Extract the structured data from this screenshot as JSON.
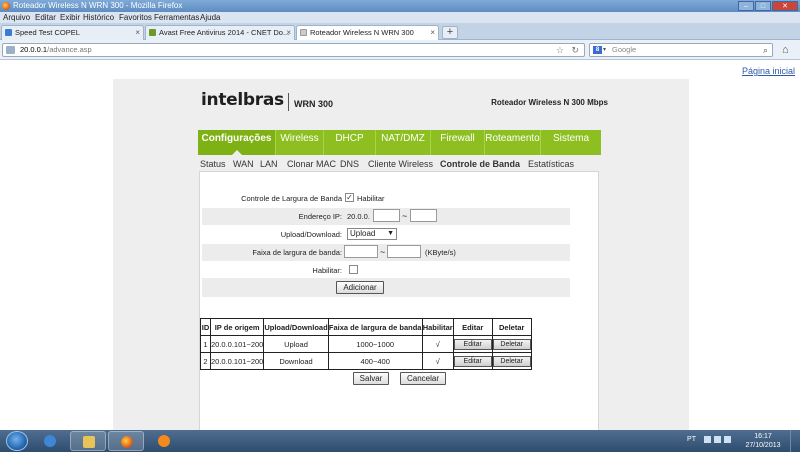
{
  "window": {
    "title": "Roteador Wireless N WRN 300 - Mozilla Firefox"
  },
  "menu": {
    "items": [
      "Arquivo",
      "Editar",
      "Exibir",
      "Histórico",
      "Favoritos",
      "Ferramentas",
      "Ajuda"
    ]
  },
  "tabs": [
    {
      "label": "Speed Test COPEL",
      "active": false,
      "favicon_color": "#3a7bd5"
    },
    {
      "label": "Avast Free Antivirus 2014 - CNET Do...",
      "active": false,
      "favicon_color": "#6b9a2a"
    },
    {
      "label": "Roteador Wireless N WRN 300",
      "active": true,
      "favicon_color": "#cccccc"
    }
  ],
  "toolbar": {
    "url_host": "20.0.0.1",
    "url_path": "/advance.asp",
    "search_placeholder": "Google",
    "search_engine_letter": "8"
  },
  "page": {
    "top_link": "Página inicial",
    "logo": "intelbras",
    "model": "WRN 300",
    "product_title": "Roteador Wireless N 300 Mbps",
    "main_nav": [
      {
        "label": "Configurações",
        "active": true
      },
      {
        "label": "Wireless",
        "active": false
      },
      {
        "label": "DHCP",
        "active": false
      },
      {
        "label": "NAT/DMZ",
        "active": false
      },
      {
        "label": "Firewall",
        "active": false
      },
      {
        "label": "Roteamento",
        "active": false
      },
      {
        "label": "Sistema",
        "active": false
      }
    ],
    "sub_nav": [
      {
        "label": "Status",
        "active": false
      },
      {
        "label": "WAN",
        "active": false
      },
      {
        "label": "LAN",
        "active": false
      },
      {
        "label": "Clonar MAC",
        "active": false
      },
      {
        "label": "DNS",
        "active": false
      },
      {
        "label": "Cliente Wireless",
        "active": false
      },
      {
        "label": "Controle de Banda",
        "active": true
      },
      {
        "label": "Estatísticas",
        "active": false
      }
    ],
    "form": {
      "bw_control_label": "Controle de Largura de Banda",
      "bw_control_enable_label": "Habilitar",
      "bw_control_enabled": true,
      "ip_label": "Endereço IP:",
      "ip_prefix": "20.0.0.",
      "ip_separator": "~",
      "ip_start": "",
      "ip_end": "",
      "direction_label": "Upload/Download:",
      "direction_value": "Upload",
      "band_label": "Faixa de largura de banda:",
      "band_separator": "~",
      "band_min": "",
      "band_max": "",
      "band_unit": "(KByte/s)",
      "enable_label": "Habilitar:",
      "enable_checked": false,
      "add_button": "Adicionar"
    },
    "table": {
      "headers": [
        "ID",
        "IP de origem",
        "Upload/Download",
        "Faixa de largura de banda",
        "Habilitar",
        "Editar",
        "Deletar"
      ],
      "rows": [
        {
          "id": "1",
          "ip": "20.0.0.101~200",
          "direction": "Upload",
          "band": "1000~1000",
          "enabled": "√",
          "edit": "Editar",
          "delete": "Deletar"
        },
        {
          "id": "2",
          "ip": "20.0.0.101~200",
          "direction": "Download",
          "band": "400~400",
          "enabled": "√",
          "edit": "Editar",
          "delete": "Deletar"
        }
      ]
    },
    "save_button": "Salvar",
    "cancel_button": "Cancelar"
  },
  "taskbar": {
    "language": "PT",
    "time": "16:17",
    "date": "27/10/2013"
  }
}
